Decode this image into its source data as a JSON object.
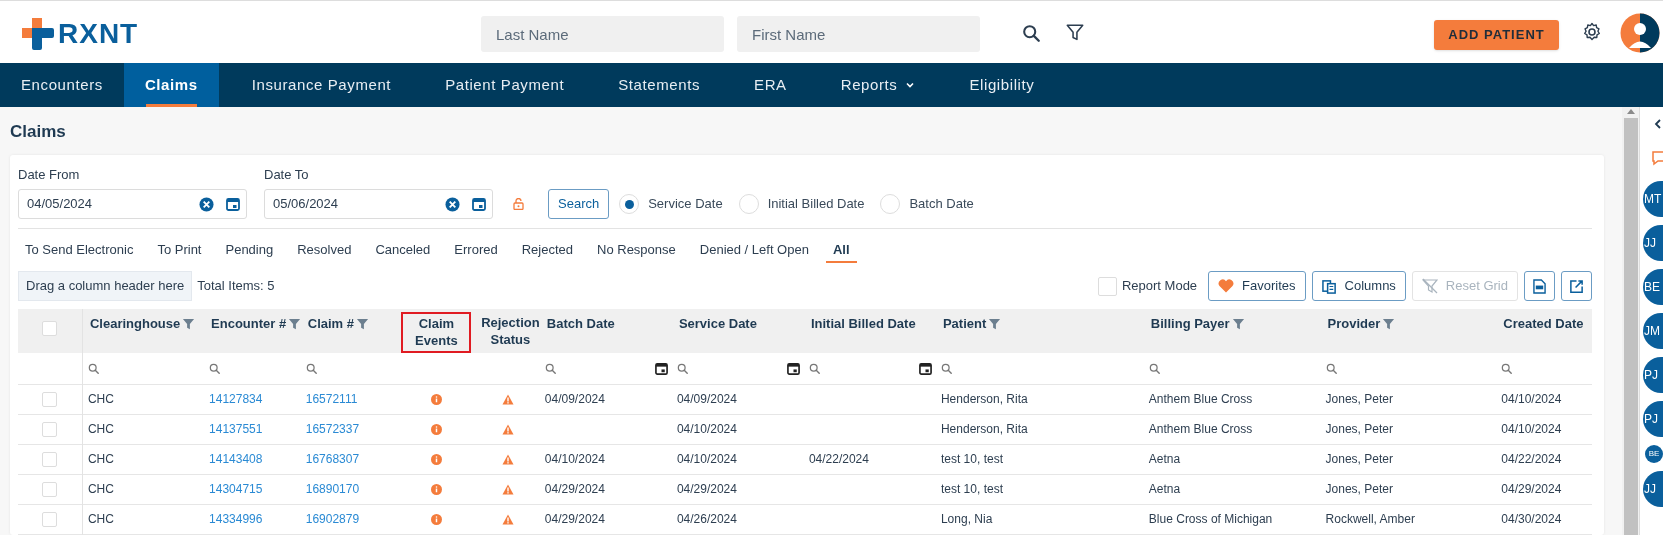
{
  "header": {
    "logo_text": "RXNT",
    "search_fields": [
      {
        "placeholder": "Last Name"
      },
      {
        "placeholder": "First Name"
      }
    ],
    "add_button": "ADD PATIENT"
  },
  "nav": [
    {
      "label": "Encounters",
      "selected": false
    },
    {
      "label": "Claims",
      "selected": true
    },
    {
      "label": "Insurance Payment",
      "selected": false
    },
    {
      "label": "Patient Payment",
      "selected": false
    },
    {
      "label": "Statements",
      "selected": false
    },
    {
      "label": "ERA",
      "selected": false
    },
    {
      "label": "Reports",
      "selected": false,
      "dropdown": true
    },
    {
      "label": "Eligibility",
      "selected": false
    }
  ],
  "page_title": "Claims",
  "date_filters": [
    {
      "label": "Date From",
      "value": "04/05/2024"
    },
    {
      "label": "Date To",
      "value": "05/06/2024"
    }
  ],
  "search_button": "Search",
  "date_types": [
    {
      "label": "Service Date",
      "selected": true
    },
    {
      "label": "Initial Billed Date",
      "selected": false
    },
    {
      "label": "Batch Date",
      "selected": false
    }
  ],
  "status_tabs": [
    {
      "label": "To Send Electronic",
      "selected": false
    },
    {
      "label": "To Print",
      "selected": false
    },
    {
      "label": "Pending",
      "selected": false
    },
    {
      "label": "Resolved",
      "selected": false
    },
    {
      "label": "Canceled",
      "selected": false
    },
    {
      "label": "Errored",
      "selected": false
    },
    {
      "label": "Rejected",
      "selected": false
    },
    {
      "label": "No Response",
      "selected": false
    },
    {
      "label": "Denied / Left Open",
      "selected": false
    },
    {
      "label": "All",
      "selected": true
    }
  ],
  "group_drop_hint": "Drag a column header here",
  "total_items": "Total Items: 5",
  "report_mode": {
    "label": "Report Mode",
    "checked": false
  },
  "toolbar_buttons": [
    {
      "label": "Favorites",
      "kind": "favorites",
      "disabled": false
    },
    {
      "label": "Columns",
      "kind": "columns",
      "disabled": false
    },
    {
      "label": "Reset Grid",
      "kind": "reset",
      "disabled": true
    },
    {
      "kind": "pdf",
      "disabled": false
    },
    {
      "kind": "export",
      "disabled": false
    }
  ],
  "table": {
    "all_selected": false,
    "columns": [
      {
        "label": "Clearinghouse",
        "filter_icon": true,
        "search_filter": true,
        "date_picker": false,
        "kind": "text",
        "highlighted": false
      },
      {
        "label": "Encounter #",
        "filter_icon": true,
        "search_filter": true,
        "date_picker": false,
        "kind": "link",
        "highlighted": false
      },
      {
        "label": "Claim #",
        "filter_icon": true,
        "search_filter": true,
        "date_picker": false,
        "kind": "link",
        "highlighted": false
      },
      {
        "label": "Claim Events",
        "filter_icon": false,
        "search_filter": false,
        "date_picker": false,
        "kind": "info_icon",
        "highlighted": true
      },
      {
        "label": "Rejection Status",
        "filter_icon": false,
        "search_filter": false,
        "date_picker": false,
        "kind": "warning_icon",
        "highlighted": false
      },
      {
        "label": "Batch Date",
        "filter_icon": false,
        "search_filter": true,
        "date_picker": true,
        "kind": "text",
        "highlighted": false
      },
      {
        "label": "Service Date",
        "filter_icon": false,
        "search_filter": true,
        "date_picker": true,
        "kind": "text",
        "highlighted": false
      },
      {
        "label": "Initial Billed Date",
        "filter_icon": false,
        "search_filter": true,
        "date_picker": true,
        "kind": "text",
        "highlighted": false
      },
      {
        "label": "Patient",
        "filter_icon": true,
        "search_filter": true,
        "date_picker": false,
        "kind": "text",
        "highlighted": false
      },
      {
        "label": "Billing Payer",
        "filter_icon": true,
        "search_filter": true,
        "date_picker": false,
        "kind": "text",
        "highlighted": false
      },
      {
        "label": "Provider",
        "filter_icon": true,
        "search_filter": true,
        "date_picker": false,
        "kind": "text",
        "highlighted": false
      },
      {
        "label": "Created Date",
        "filter_icon": false,
        "search_filter": true,
        "date_picker": false,
        "kind": "text",
        "highlighted": false
      }
    ],
    "rows": [
      {
        "selected": false,
        "cells": [
          "CHC",
          "14127834",
          "16572111",
          "",
          "",
          "04/09/2024",
          "04/09/2024",
          "",
          "Henderson, Rita",
          "Anthem Blue Cross",
          "Jones, Peter",
          "04/10/2024"
        ]
      },
      {
        "selected": false,
        "cells": [
          "CHC",
          "14137551",
          "16572337",
          "",
          "",
          "",
          "04/10/2024",
          "",
          "Henderson, Rita",
          "Anthem Blue Cross",
          "Jones, Peter",
          "04/10/2024"
        ]
      },
      {
        "selected": false,
        "cells": [
          "CHC",
          "14143408",
          "16768307",
          "",
          "",
          "04/10/2024",
          "04/10/2024",
          "04/22/2024",
          "test 10, test",
          "Aetna",
          "Jones, Peter",
          "04/22/2024"
        ]
      },
      {
        "selected": false,
        "cells": [
          "CHC",
          "14304715",
          "16890170",
          "",
          "",
          "04/29/2024",
          "04/29/2024",
          "",
          "test 10, test",
          "Aetna",
          "Jones, Peter",
          "04/29/2024"
        ]
      },
      {
        "selected": false,
        "cells": [
          "CHC",
          "14334996",
          "16902879",
          "",
          "",
          "04/29/2024",
          "04/26/2024",
          "",
          "Long, Nia",
          "Blue Cross of Michigan",
          "Rockwell, Amber",
          "04/30/2024"
        ]
      }
    ]
  },
  "side_avatars": [
    {
      "initials": "MT",
      "kind": "avatar"
    },
    {
      "initials": "JJ",
      "kind": "avatar"
    },
    {
      "initials": "BE",
      "kind": "avatar"
    },
    {
      "initials": "JM",
      "kind": "avatar"
    },
    {
      "initials": "PJ",
      "kind": "avatar"
    },
    {
      "initials": "PJ",
      "kind": "avatar"
    },
    {
      "initials": "BE",
      "kind": "mini"
    },
    {
      "initials": "JJ",
      "kind": "avatar"
    }
  ]
}
